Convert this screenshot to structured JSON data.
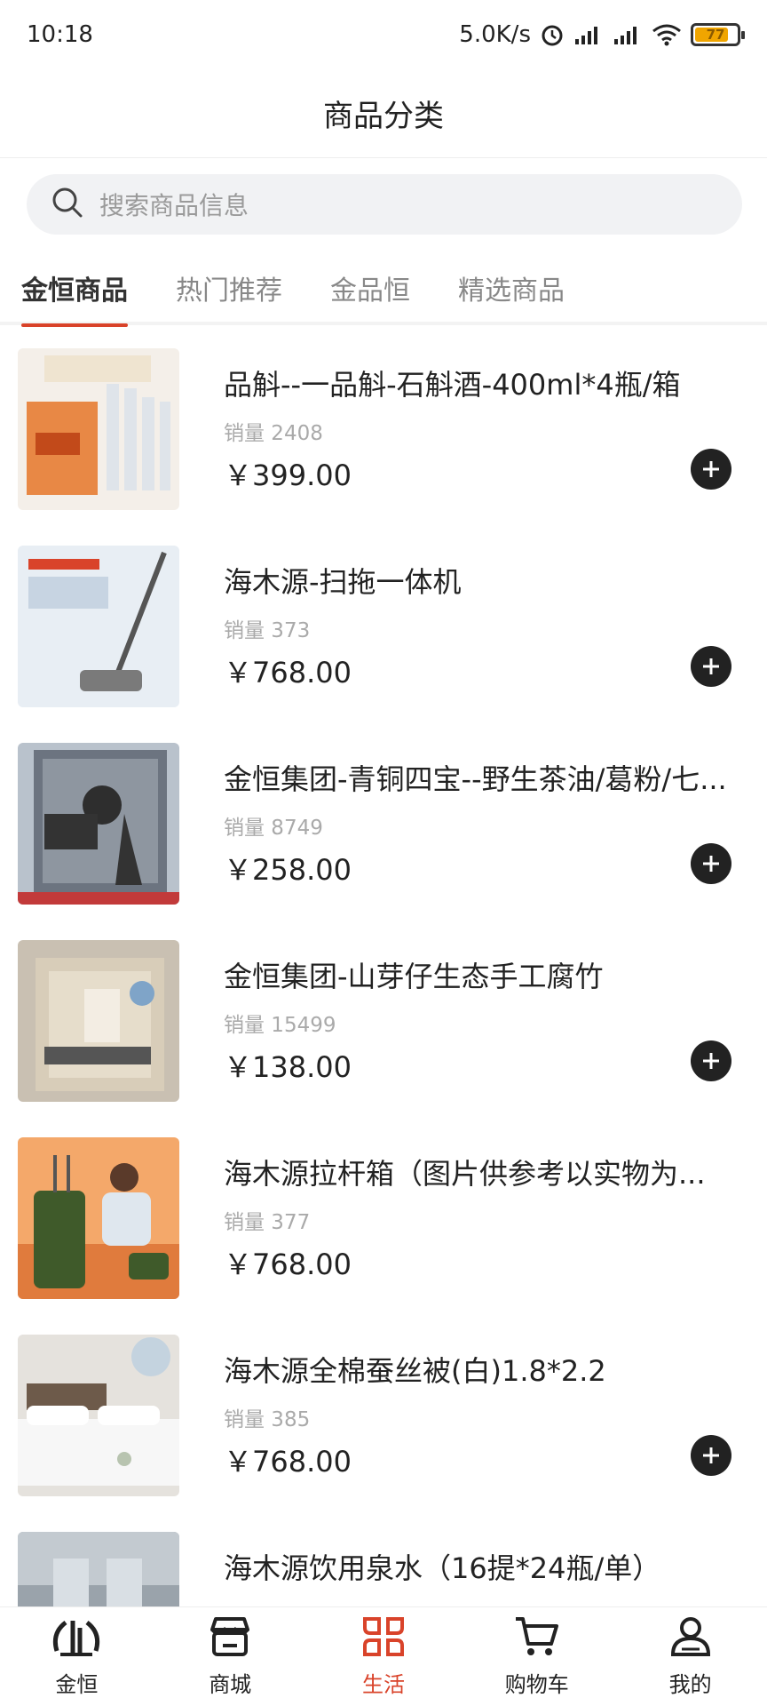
{
  "status_bar": {
    "time": "10:18",
    "speed": "5.0K/s",
    "battery": "77"
  },
  "header": {
    "title": "商品分类"
  },
  "search": {
    "placeholder": "搜索商品信息"
  },
  "tabs": [
    {
      "label": "金恒商品",
      "active": true
    },
    {
      "label": "热门推荐",
      "active": false
    },
    {
      "label": "金品恒",
      "active": false
    },
    {
      "label": "精选商品",
      "active": false
    }
  ],
  "products": [
    {
      "title": "品斛--一品斛-石斛酒-400ml*4瓶/箱",
      "sales": "销量 2408",
      "price": "￥399.00"
    },
    {
      "title": "海木源-扫拖一体机",
      "sales": "销量 373",
      "price": "￥768.00"
    },
    {
      "title": "金恒集团-青铜四宝--野生茶油/葛粉/七...",
      "sales": "销量 8749",
      "price": "￥258.00"
    },
    {
      "title": "金恒集团-山芽仔生态手工腐竹",
      "sales": "销量 15499",
      "price": "￥138.00"
    },
    {
      "title": "海木源拉杆箱（图片供参考以实物为...",
      "sales": "销量 377",
      "price": "￥768.00"
    },
    {
      "title": "海木源全棉蚕丝被(白)1.8*2.2",
      "sales": "销量 385",
      "price": "￥768.00"
    },
    {
      "title": "海木源饮用泉水（16提*24瓶/单）",
      "sales": "",
      "price": ""
    }
  ],
  "bottom_nav": [
    {
      "label": "金恒",
      "icon": "jinheng-logo-icon",
      "active": false
    },
    {
      "label": "商城",
      "icon": "shop-icon",
      "active": false
    },
    {
      "label": "生活",
      "icon": "life-icon",
      "active": true
    },
    {
      "label": "购物车",
      "icon": "cart-icon",
      "active": false
    },
    {
      "label": "我的",
      "icon": "user-icon",
      "active": false
    }
  ],
  "colors": {
    "accent": "#d9432a",
    "text": "#222222",
    "muted": "#aaaaaa"
  }
}
